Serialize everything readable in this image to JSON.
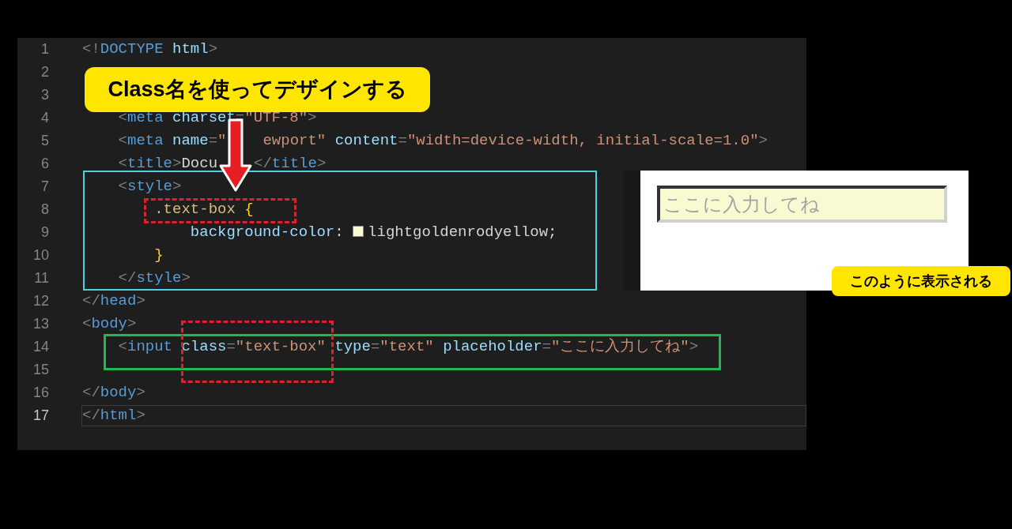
{
  "editor": {
    "lines": [
      {
        "number": "1",
        "current": false,
        "tokens": [
          {
            "kind": "punct",
            "text": "<!"
          },
          {
            "kind": "tag",
            "text": "DOCTYPE"
          },
          {
            "kind": "attr",
            "text": " html"
          },
          {
            "kind": "punct",
            "text": ">"
          }
        ]
      },
      {
        "number": "2",
        "current": false
      },
      {
        "number": "3",
        "current": false
      },
      {
        "number": "4",
        "current": false,
        "tokens": [
          {
            "kind": "punct",
            "text": "    <"
          },
          {
            "kind": "tag",
            "text": "meta"
          },
          {
            "kind": "attr",
            "text": " charset"
          },
          {
            "kind": "punct",
            "text": "="
          },
          {
            "kind": "string",
            "text": "\"UTF-8\""
          },
          {
            "kind": "punct",
            "text": ">"
          }
        ]
      },
      {
        "number": "5",
        "current": false,
        "tokens": [
          {
            "kind": "punct",
            "text": "    <"
          },
          {
            "kind": "tag",
            "text": "meta"
          },
          {
            "kind": "attr",
            "text": " name"
          },
          {
            "kind": "punct",
            "text": "="
          },
          {
            "kind": "string",
            "text": "\""
          },
          {
            "kind": "covered"
          },
          {
            "kind": "string",
            "text": "ewport\""
          },
          {
            "kind": "attr",
            "text": " content"
          },
          {
            "kind": "punct",
            "text": "="
          },
          {
            "kind": "string",
            "text": "\"width=device-width, initial-scale=1.0\""
          },
          {
            "kind": "punct",
            "text": ">"
          }
        ]
      },
      {
        "number": "6",
        "current": false,
        "tokens": [
          {
            "kind": "punct",
            "text": "    <"
          },
          {
            "kind": "tag",
            "text": "title"
          },
          {
            "kind": "punct",
            "text": ">"
          },
          {
            "kind": "plain",
            "text": "Docu"
          },
          {
            "kind": "covered"
          },
          {
            "kind": "punct",
            "text": "</"
          },
          {
            "kind": "tag",
            "text": "title"
          },
          {
            "kind": "punct",
            "text": ">"
          }
        ]
      },
      {
        "number": "7",
        "current": false,
        "tokens": [
          {
            "kind": "punct",
            "text": "    <"
          },
          {
            "kind": "tag",
            "text": "style"
          },
          {
            "kind": "punct",
            "text": ">"
          }
        ]
      },
      {
        "number": "8",
        "current": false,
        "tokens": [
          {
            "kind": "selector",
            "text": "        .text-box"
          },
          {
            "kind": "brace",
            "text": " {"
          }
        ]
      },
      {
        "number": "9",
        "current": false,
        "tokens": [
          {
            "kind": "attr",
            "text": "            background-color"
          },
          {
            "kind": "plain",
            "text": ": "
          },
          {
            "kind": "swatch",
            "color": "#fafad2"
          },
          {
            "kind": "plain",
            "text": "lightgoldenrodyellow;"
          }
        ]
      },
      {
        "number": "10",
        "current": false,
        "tokens": [
          {
            "kind": "brace",
            "text": "        }"
          }
        ]
      },
      {
        "number": "11",
        "current": false,
        "tokens": [
          {
            "kind": "punct",
            "text": "    </"
          },
          {
            "kind": "tag",
            "text": "style"
          },
          {
            "kind": "punct",
            "text": ">"
          }
        ]
      },
      {
        "number": "12",
        "current": false,
        "tokens": [
          {
            "kind": "punct",
            "text": "</"
          },
          {
            "kind": "tag",
            "text": "head"
          },
          {
            "kind": "punct",
            "text": ">"
          }
        ]
      },
      {
        "number": "13",
        "current": false,
        "tokens": [
          {
            "kind": "punct",
            "text": "<"
          },
          {
            "kind": "tag",
            "text": "body"
          },
          {
            "kind": "punct",
            "text": ">"
          }
        ]
      },
      {
        "number": "14",
        "current": false,
        "tokens": [
          {
            "kind": "punct",
            "text": "    <"
          },
          {
            "kind": "tag",
            "text": "input"
          },
          {
            "kind": "attr",
            "text": " class"
          },
          {
            "kind": "punct",
            "text": "="
          },
          {
            "kind": "string",
            "text": "\"text-box\""
          },
          {
            "kind": "attr",
            "text": " type"
          },
          {
            "kind": "punct",
            "text": "="
          },
          {
            "kind": "string",
            "text": "\"text\""
          },
          {
            "kind": "attr",
            "text": " placeholder"
          },
          {
            "kind": "punct",
            "text": "="
          },
          {
            "kind": "string",
            "text": "\"ここに入力してね\""
          },
          {
            "kind": "punct",
            "text": ">"
          }
        ]
      },
      {
        "number": "15",
        "current": false
      },
      {
        "number": "16",
        "current": false,
        "tokens": [
          {
            "kind": "punct",
            "text": "</"
          },
          {
            "kind": "tag",
            "text": "body"
          },
          {
            "kind": "punct",
            "text": ">"
          }
        ]
      },
      {
        "number": "17",
        "current": true,
        "tokens": [
          {
            "kind": "punct",
            "text": "</"
          },
          {
            "kind": "tag",
            "text": "html"
          },
          {
            "kind": "punct",
            "text": ">"
          }
        ]
      }
    ]
  },
  "title_callout": "Class名を使ってデザインする",
  "preview": {
    "input": {
      "placeholder": "ここに入力してね"
    }
  },
  "result_callout": "このように表示される"
}
